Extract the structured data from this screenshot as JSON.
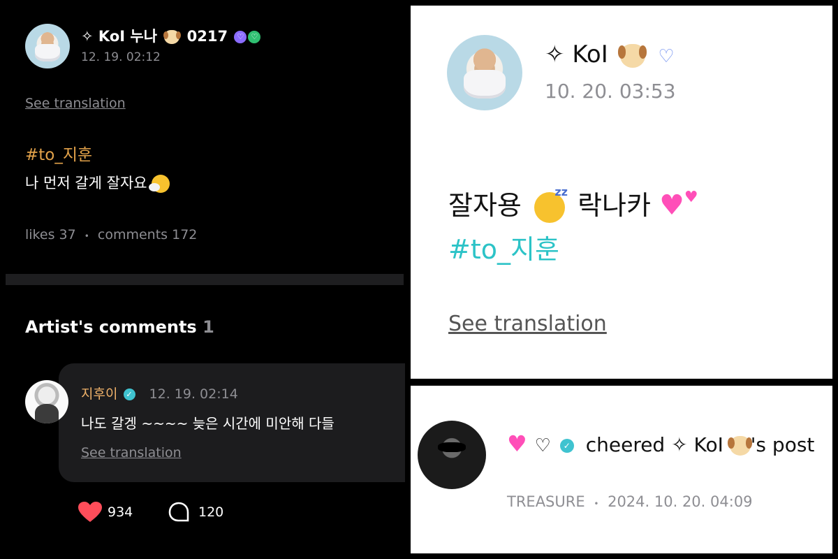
{
  "left": {
    "post": {
      "author_prefix": "✧ ",
      "author_name": "KoI 누나",
      "author_suffix": "0217",
      "time": "12. 19. 02:12",
      "see_translation": "See translation",
      "hashtag": "#to_지훈",
      "body": "나 먼저 갈게  잘자요",
      "likes_label": "likes",
      "likes_count": "37",
      "separator": "•",
      "comments_label": "comments",
      "comments_count": "172"
    },
    "artist_comments": {
      "heading": "Artist's comments",
      "count": "1",
      "comment": {
        "name": "지후이",
        "time": "12. 19. 02:14",
        "text": "나도 갈겡 ~~~~ 늦은 시간에 미안해 다들",
        "see_translation": "See translation"
      },
      "reactions": {
        "likes": "934",
        "replies": "120"
      }
    }
  },
  "right_top": {
    "author_prefix": "✧",
    "author_name": "KoI",
    "time": "10. 20. 03:53",
    "body": "잘자용",
    "body_mid": "락나카",
    "hashtag": "#to_지훈",
    "see_translation": "See translation"
  },
  "right_bottom": {
    "cheer_text": "cheered ✧ KoI",
    "cheer_suffix": "'s post",
    "group": "TREASURE",
    "separator": "•",
    "date": "2024. 10. 20. 04:09"
  },
  "colors": {
    "hashtag_left": "#e2a24a",
    "hashtag_right": "#2cc3c7",
    "artist_name": "#f0b26a",
    "verified": "#3fc3d0",
    "heart": "#ff4d5a"
  },
  "icons": [
    "sparkle-icon",
    "dog-emoji-icon",
    "heart-badge-icon",
    "sneeze-face-icon",
    "verified-icon",
    "heart-icon",
    "comment-bubble-icon",
    "sleeping-face-icon",
    "two-hearts-icon",
    "sparkling-heart-icon"
  ]
}
